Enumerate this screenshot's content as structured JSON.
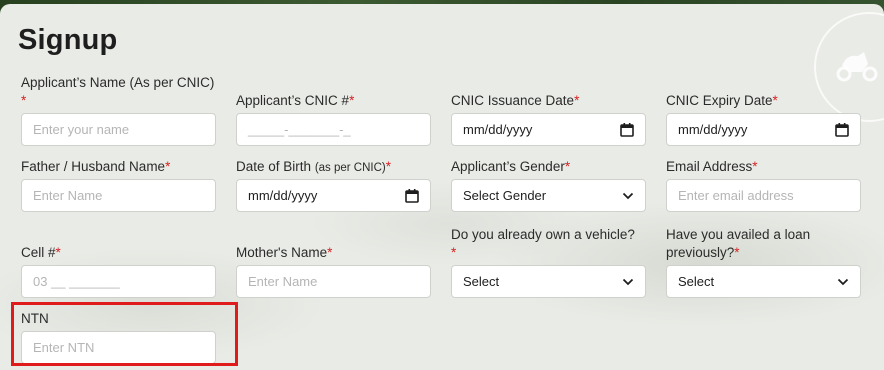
{
  "title": "Signup",
  "fields": [
    {
      "label": "Applicant’s Name (As per CNIC)",
      "req": " *",
      "placeholder": "Enter your name"
    },
    {
      "label": "Applicant’s CNIC #",
      "req": "*",
      "placeholder": "_____-_______-_"
    },
    {
      "label": "CNIC Issuance Date",
      "req": "*",
      "value": "mm/dd/yyyy"
    },
    {
      "label": "CNIC Expiry Date",
      "req": "*",
      "value": "mm/dd/yyyy"
    },
    {
      "label": "Father / Husband Name",
      "req": "*",
      "placeholder": "Enter Name"
    },
    {
      "label": "Date of Birth",
      "note": "(as per CNIC)",
      "req": "*",
      "value": "mm/dd/yyyy"
    },
    {
      "label": "Applicant’s Gender",
      "req": "*",
      "value": "Select Gender"
    },
    {
      "label": "Email Address",
      "req": "*",
      "placeholder": "Enter email address"
    },
    {
      "label": "Cell #",
      "req": "*",
      "placeholder": "03 __ _______"
    },
    {
      "label": "Mother's Name",
      "req": "*",
      "placeholder": "Enter Name"
    },
    {
      "label": "Do you already own a vehicle?",
      "req": "*",
      "value": "Select"
    },
    {
      "label": "Have you availed a loan previously?",
      "req": "*",
      "value": "Select"
    },
    {
      "label": "NTN",
      "req": "",
      "placeholder": "Enter NTN"
    }
  ],
  "colors": {
    "required": "#d62222",
    "highlight": "#e01b1b"
  },
  "icons": {
    "date": "calendar-icon",
    "select": "chevron-down-icon",
    "emblem": "scooter-icon"
  }
}
